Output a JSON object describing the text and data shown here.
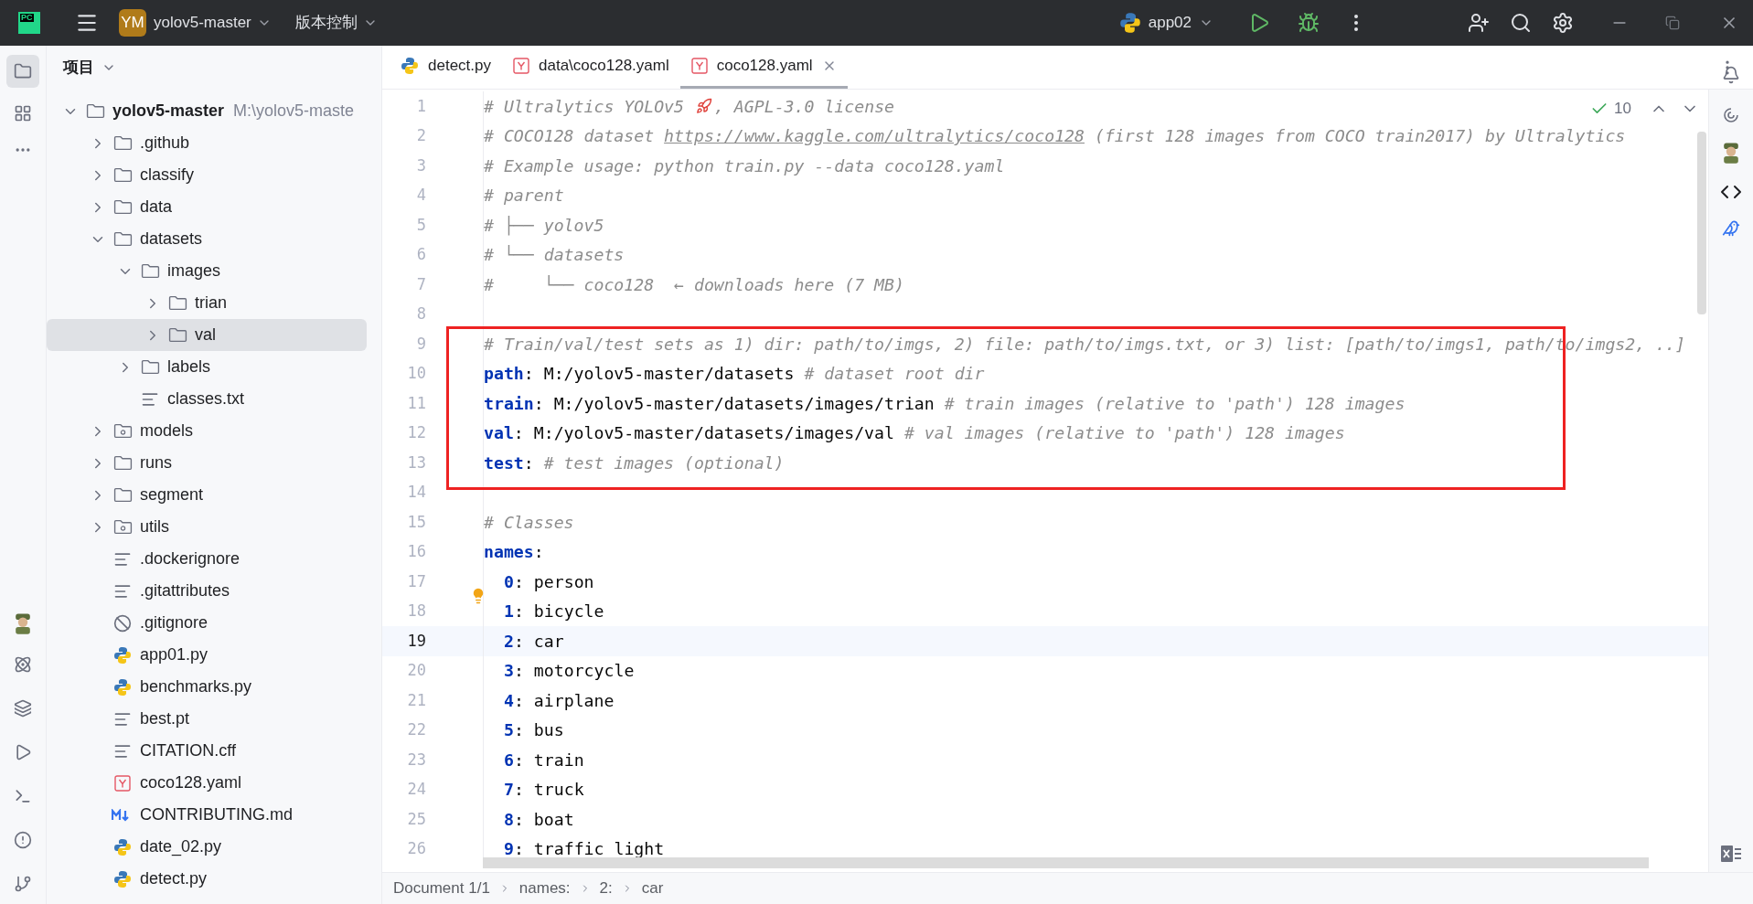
{
  "title_bar": {
    "logo_text": "PC",
    "project_badge": "YM",
    "project_name": "yolov5-master",
    "vcs_menu": "版本控制",
    "run_config": "app02"
  },
  "project_panel": {
    "title": "项目",
    "tree": [
      {
        "label": "yolov5-master",
        "path_hint": "M:\\yolov5-maste",
        "kind": "folder",
        "expanded": true,
        "selected": false,
        "bold": true,
        "children": [
          {
            "label": ".github",
            "kind": "folder",
            "expanded": false,
            "selected": false
          },
          {
            "label": "classify",
            "kind": "folder",
            "expanded": false,
            "selected": false
          },
          {
            "label": "data",
            "kind": "folder",
            "expanded": false,
            "selected": false
          },
          {
            "label": "datasets",
            "kind": "folder",
            "expanded": true,
            "selected": false,
            "children": [
              {
                "label": "images",
                "kind": "folder",
                "expanded": true,
                "selected": false,
                "children": [
                  {
                    "label": "trian",
                    "kind": "folder",
                    "expanded": false,
                    "selected": false
                  },
                  {
                    "label": "val",
                    "kind": "folder",
                    "expanded": false,
                    "selected": true
                  }
                ]
              },
              {
                "label": "labels",
                "kind": "folder",
                "expanded": false,
                "selected": false
              },
              {
                "label": "classes.txt",
                "kind": "text",
                "selected": false
              }
            ]
          },
          {
            "label": "models",
            "kind": "package",
            "expanded": false,
            "selected": false
          },
          {
            "label": "runs",
            "kind": "folder",
            "expanded": false,
            "selected": false
          },
          {
            "label": "segment",
            "kind": "folder",
            "expanded": false,
            "selected": false
          },
          {
            "label": "utils",
            "kind": "package",
            "expanded": false,
            "selected": false
          },
          {
            "label": ".dockerignore",
            "kind": "text",
            "selected": false
          },
          {
            "label": ".gitattributes",
            "kind": "text",
            "selected": false
          },
          {
            "label": ".gitignore",
            "kind": "ignore",
            "selected": false
          },
          {
            "label": "app01.py",
            "kind": "python",
            "selected": false
          },
          {
            "label": "benchmarks.py",
            "kind": "python",
            "selected": false
          },
          {
            "label": "best.pt",
            "kind": "text",
            "selected": false
          },
          {
            "label": "CITATION.cff",
            "kind": "text",
            "selected": false
          },
          {
            "label": "coco128.yaml",
            "kind": "yaml",
            "selected": false
          },
          {
            "label": "CONTRIBUTING.md",
            "kind": "markdown",
            "selected": false
          },
          {
            "label": "date_02.py",
            "kind": "python",
            "selected": false
          },
          {
            "label": "detect.py",
            "kind": "python",
            "selected": false
          }
        ]
      }
    ]
  },
  "tabs": [
    {
      "label": "detect.py",
      "kind": "python",
      "selected": false
    },
    {
      "label": "data\\coco128.yaml",
      "kind": "yaml",
      "selected": false
    },
    {
      "label": "coco128.yaml",
      "kind": "yaml",
      "selected": true
    }
  ],
  "inspections": "10",
  "code_lines": [
    {
      "number": "1",
      "current": false,
      "tokens": [
        {
          "kind": "comment",
          "text": "# Ultralytics YOLOv5 "
        },
        {
          "kind": "rocket"
        },
        {
          "kind": "comment",
          "text": ", AGPL-3.0 license"
        }
      ]
    },
    {
      "number": "2",
      "current": false,
      "tokens": [
        {
          "kind": "comment",
          "text": "# COCO128 dataset "
        },
        {
          "kind": "link",
          "text": "https://www.kaggle.com/ultralytics/coco128"
        },
        {
          "kind": "comment",
          "text": " (first 128 images from COCO train2017) by Ultralytics"
        }
      ]
    },
    {
      "number": "3",
      "current": false,
      "tokens": [
        {
          "kind": "comment",
          "text": "# Example usage: python train.py --data coco128.yaml"
        }
      ]
    },
    {
      "number": "4",
      "current": false,
      "tokens": [
        {
          "kind": "comment",
          "text": "# parent"
        }
      ]
    },
    {
      "number": "5",
      "current": false,
      "tokens": [
        {
          "kind": "comment",
          "text": "# ├── yolov5"
        }
      ]
    },
    {
      "number": "6",
      "current": false,
      "tokens": [
        {
          "kind": "comment",
          "text": "# └── datasets"
        }
      ]
    },
    {
      "number": "7",
      "current": false,
      "tokens": [
        {
          "kind": "comment",
          "text": "#     └── coco128  ← downloads here (7 MB)"
        }
      ]
    },
    {
      "number": "8",
      "current": false
    },
    {
      "number": "9",
      "current": false,
      "tokens": [
        {
          "kind": "comment",
          "text": "# Train/val/test sets as 1) dir: path/to/imgs, 2) file: path/to/imgs.txt, or 3) list: [path/to/imgs1, path/to/imgs2, ..]"
        }
      ]
    },
    {
      "number": "10",
      "current": false,
      "tokens": [
        {
          "kind": "key",
          "text": "path"
        },
        {
          "kind": "plain",
          "text": ": M:/yolov5-master/datasets "
        },
        {
          "kind": "comment",
          "text": "# dataset root dir"
        }
      ]
    },
    {
      "number": "11",
      "current": false,
      "tokens": [
        {
          "kind": "key",
          "text": "train"
        },
        {
          "kind": "plain",
          "text": ": M:/yolov5-master/datasets/images/trian "
        },
        {
          "kind": "comment",
          "text": "# train images (relative to 'path') 128 images"
        }
      ]
    },
    {
      "number": "12",
      "current": false,
      "tokens": [
        {
          "kind": "key",
          "text": "val"
        },
        {
          "kind": "plain",
          "text": ": M:/yolov5-master/datasets/images/val "
        },
        {
          "kind": "comment",
          "text": "# val images (relative to 'path') 128 images"
        }
      ]
    },
    {
      "number": "13",
      "current": false,
      "tokens": [
        {
          "kind": "key",
          "text": "test"
        },
        {
          "kind": "plain",
          "text": ": "
        },
        {
          "kind": "comment",
          "text": "# test images (optional)"
        }
      ]
    },
    {
      "number": "14",
      "current": false
    },
    {
      "number": "15",
      "current": false,
      "tokens": [
        {
          "kind": "comment",
          "text": "# Classes"
        }
      ]
    },
    {
      "number": "16",
      "current": false,
      "tokens": [
        {
          "kind": "key",
          "text": "names"
        },
        {
          "kind": "plain",
          "text": ":"
        }
      ]
    },
    {
      "number": "17",
      "current": false,
      "tokens": [
        {
          "kind": "index",
          "text": "0"
        },
        {
          "kind": "plain",
          "text": ": person"
        }
      ]
    },
    {
      "number": "18",
      "current": false,
      "tokens": [
        {
          "kind": "index",
          "text": "1"
        },
        {
          "kind": "plain",
          "text": ": bicycle"
        }
      ]
    },
    {
      "number": "19",
      "current": true,
      "tokens": [
        {
          "kind": "index",
          "text": "2"
        },
        {
          "kind": "plain",
          "text": ": car"
        }
      ]
    },
    {
      "number": "20",
      "current": false,
      "tokens": [
        {
          "kind": "index",
          "text": "3"
        },
        {
          "kind": "plain",
          "text": ": motorcycle"
        }
      ]
    },
    {
      "number": "21",
      "current": false,
      "tokens": [
        {
          "kind": "index",
          "text": "4"
        },
        {
          "kind": "plain",
          "text": ": airplane"
        }
      ]
    },
    {
      "number": "22",
      "current": false,
      "tokens": [
        {
          "kind": "index",
          "text": "5"
        },
        {
          "kind": "plain",
          "text": ": bus"
        }
      ]
    },
    {
      "number": "23",
      "current": false,
      "tokens": [
        {
          "kind": "index",
          "text": "6"
        },
        {
          "kind": "plain",
          "text": ": train"
        }
      ]
    },
    {
      "number": "24",
      "current": false,
      "tokens": [
        {
          "kind": "index",
          "text": "7"
        },
        {
          "kind": "plain",
          "text": ": truck"
        }
      ]
    },
    {
      "number": "25",
      "current": false,
      "tokens": [
        {
          "kind": "index",
          "text": "8"
        },
        {
          "kind": "plain",
          "text": ": boat"
        }
      ]
    },
    {
      "number": "26",
      "current": false,
      "tokens": [
        {
          "kind": "index",
          "text": "9"
        },
        {
          "kind": "plain",
          "text": ": traffic light"
        }
      ]
    }
  ],
  "breadcrumbs": [
    "Document 1/1",
    "names:",
    "2:",
    "car"
  ]
}
